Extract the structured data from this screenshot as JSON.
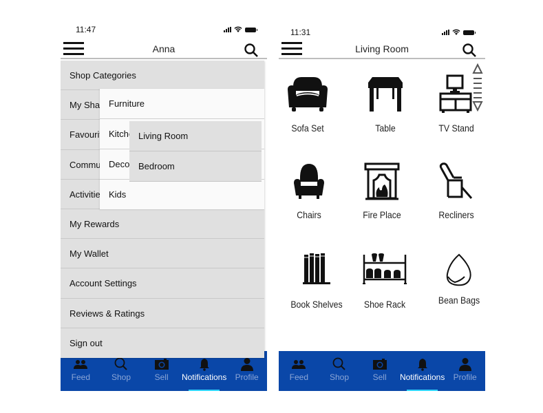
{
  "left_screen": {
    "status": {
      "time": "11:47"
    },
    "header": {
      "title": "Anna"
    },
    "drawer": {
      "items": [
        {
          "label": "Shop Categories"
        },
        {
          "label": "My Shares"
        },
        {
          "label": "Favourites"
        },
        {
          "label": "Community"
        },
        {
          "label": "Activities"
        },
        {
          "label": "My Rewards"
        },
        {
          "label": "My Wallet"
        },
        {
          "label": "Account Settings"
        },
        {
          "label": "Reviews & Ratings"
        },
        {
          "label": "Sign out"
        }
      ],
      "submenu": [
        {
          "label": "Furniture"
        },
        {
          "label": "Kitchen"
        },
        {
          "label": "Decor"
        },
        {
          "label": "Kids"
        }
      ],
      "submenu2": [
        {
          "label": "Living Room"
        },
        {
          "label": "Bedroom"
        }
      ]
    }
  },
  "right_screen": {
    "status": {
      "time": "11:31"
    },
    "header": {
      "title": "Living Room"
    },
    "categories": [
      {
        "label": "Sofa Set",
        "icon": "sofa-icon"
      },
      {
        "label": "Table",
        "icon": "table-icon"
      },
      {
        "label": "TV Stand",
        "icon": "tv-stand-icon"
      },
      {
        "label": "Chairs",
        "icon": "armchair-icon"
      },
      {
        "label": "Fire Place",
        "icon": "fireplace-icon"
      },
      {
        "label": "Recliners",
        "icon": "recliner-icon"
      },
      {
        "label": "Book Shelves",
        "icon": "books-icon"
      },
      {
        "label": "Shoe Rack",
        "icon": "shoe-rack-icon"
      },
      {
        "label": "Bean Bags",
        "icon": "bean-bag-icon"
      }
    ]
  },
  "tabbar": {
    "tabs": [
      {
        "label": "Feed",
        "icon": "people-icon"
      },
      {
        "label": "Shop",
        "icon": "search-icon"
      },
      {
        "label": "Sell",
        "icon": "camera-icon"
      },
      {
        "label": "Notifications",
        "icon": "bell-icon",
        "active": true
      },
      {
        "label": "Profile",
        "icon": "person-icon"
      }
    ]
  },
  "colors": {
    "tabbar_bg": "#0a47a8",
    "tab_active": "#ffffff",
    "tab_inactive": "#8aa5d6",
    "tab_indicator": "#2fd7ff",
    "drawer_bg": "#e0e0e0",
    "submenu_bg": "#fafafa"
  }
}
